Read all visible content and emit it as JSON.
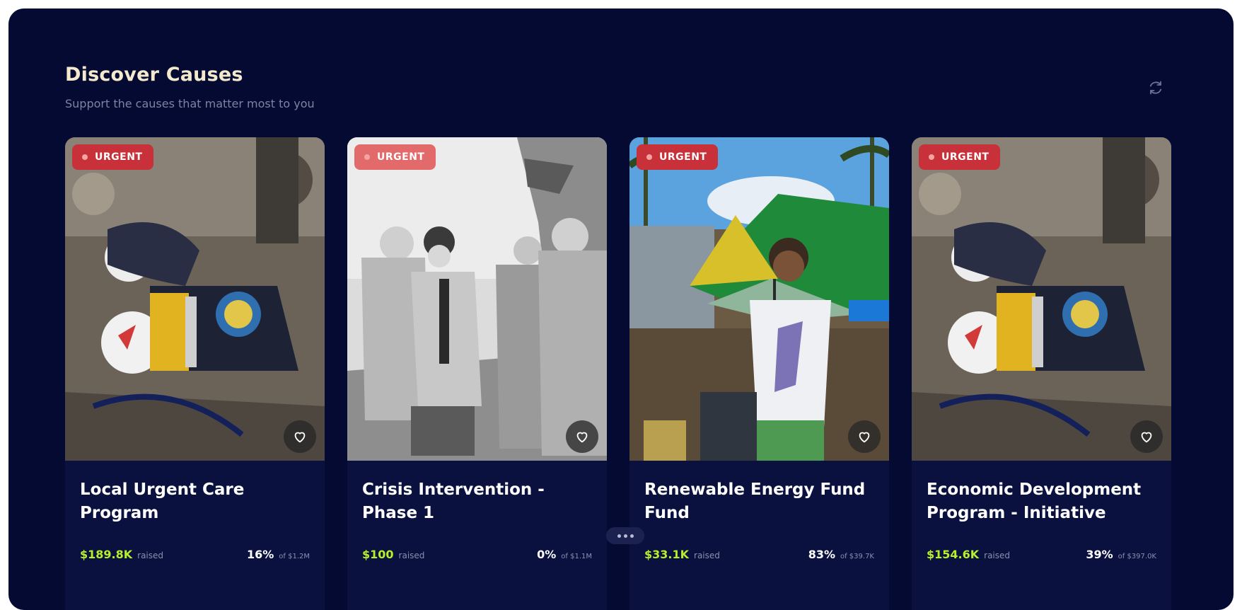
{
  "section": {
    "title": "Discover Causes",
    "subtitle": "Support the causes that matter most to you",
    "refresh_icon": "refresh-icon"
  },
  "colors": {
    "background": "#050a33",
    "card": "#0b113f",
    "title": "#f3e9cc",
    "raised": "#b6f02a",
    "urgent_badge": "#c8313a",
    "urgent_badge_light": "#e36a6a"
  },
  "cards": [
    {
      "badge": "URGENT",
      "image": "rescue-workers-in-rubble-photo",
      "title": "Local Urgent Care Program",
      "raised_amount": "$189.8K",
      "raised_label": "raised",
      "percent": "16%",
      "goal": "of $1.2M",
      "progress": 0.16,
      "favorite_icon": "heart-icon"
    },
    {
      "badge": "URGENT",
      "image": "rescue-team-at-collapsed-building-photo",
      "title": "Crisis Intervention - Phase 1",
      "raised_amount": "$100",
      "raised_label": "raised",
      "percent": "0%",
      "goal": "of $1.1M",
      "progress": 0.0,
      "favorite_icon": "heart-icon"
    },
    {
      "badge": "URGENT",
      "image": "woman-with-umbrella-photo",
      "title": "Renewable Energy Fund Fund",
      "raised_amount": "$33.1K",
      "raised_label": "raised",
      "percent": "83%",
      "goal": "of $39.7K",
      "progress": 0.83,
      "favorite_icon": "heart-icon"
    },
    {
      "badge": "URGENT",
      "image": "rescue-workers-in-rubble-photo",
      "title": "Economic Development Program - Initiative",
      "raised_amount": "$154.6K",
      "raised_label": "raised",
      "percent": "39%",
      "goal": "of $397.0K",
      "progress": 0.39,
      "favorite_icon": "heart-icon"
    }
  ],
  "more_icon": "more-dots-icon"
}
